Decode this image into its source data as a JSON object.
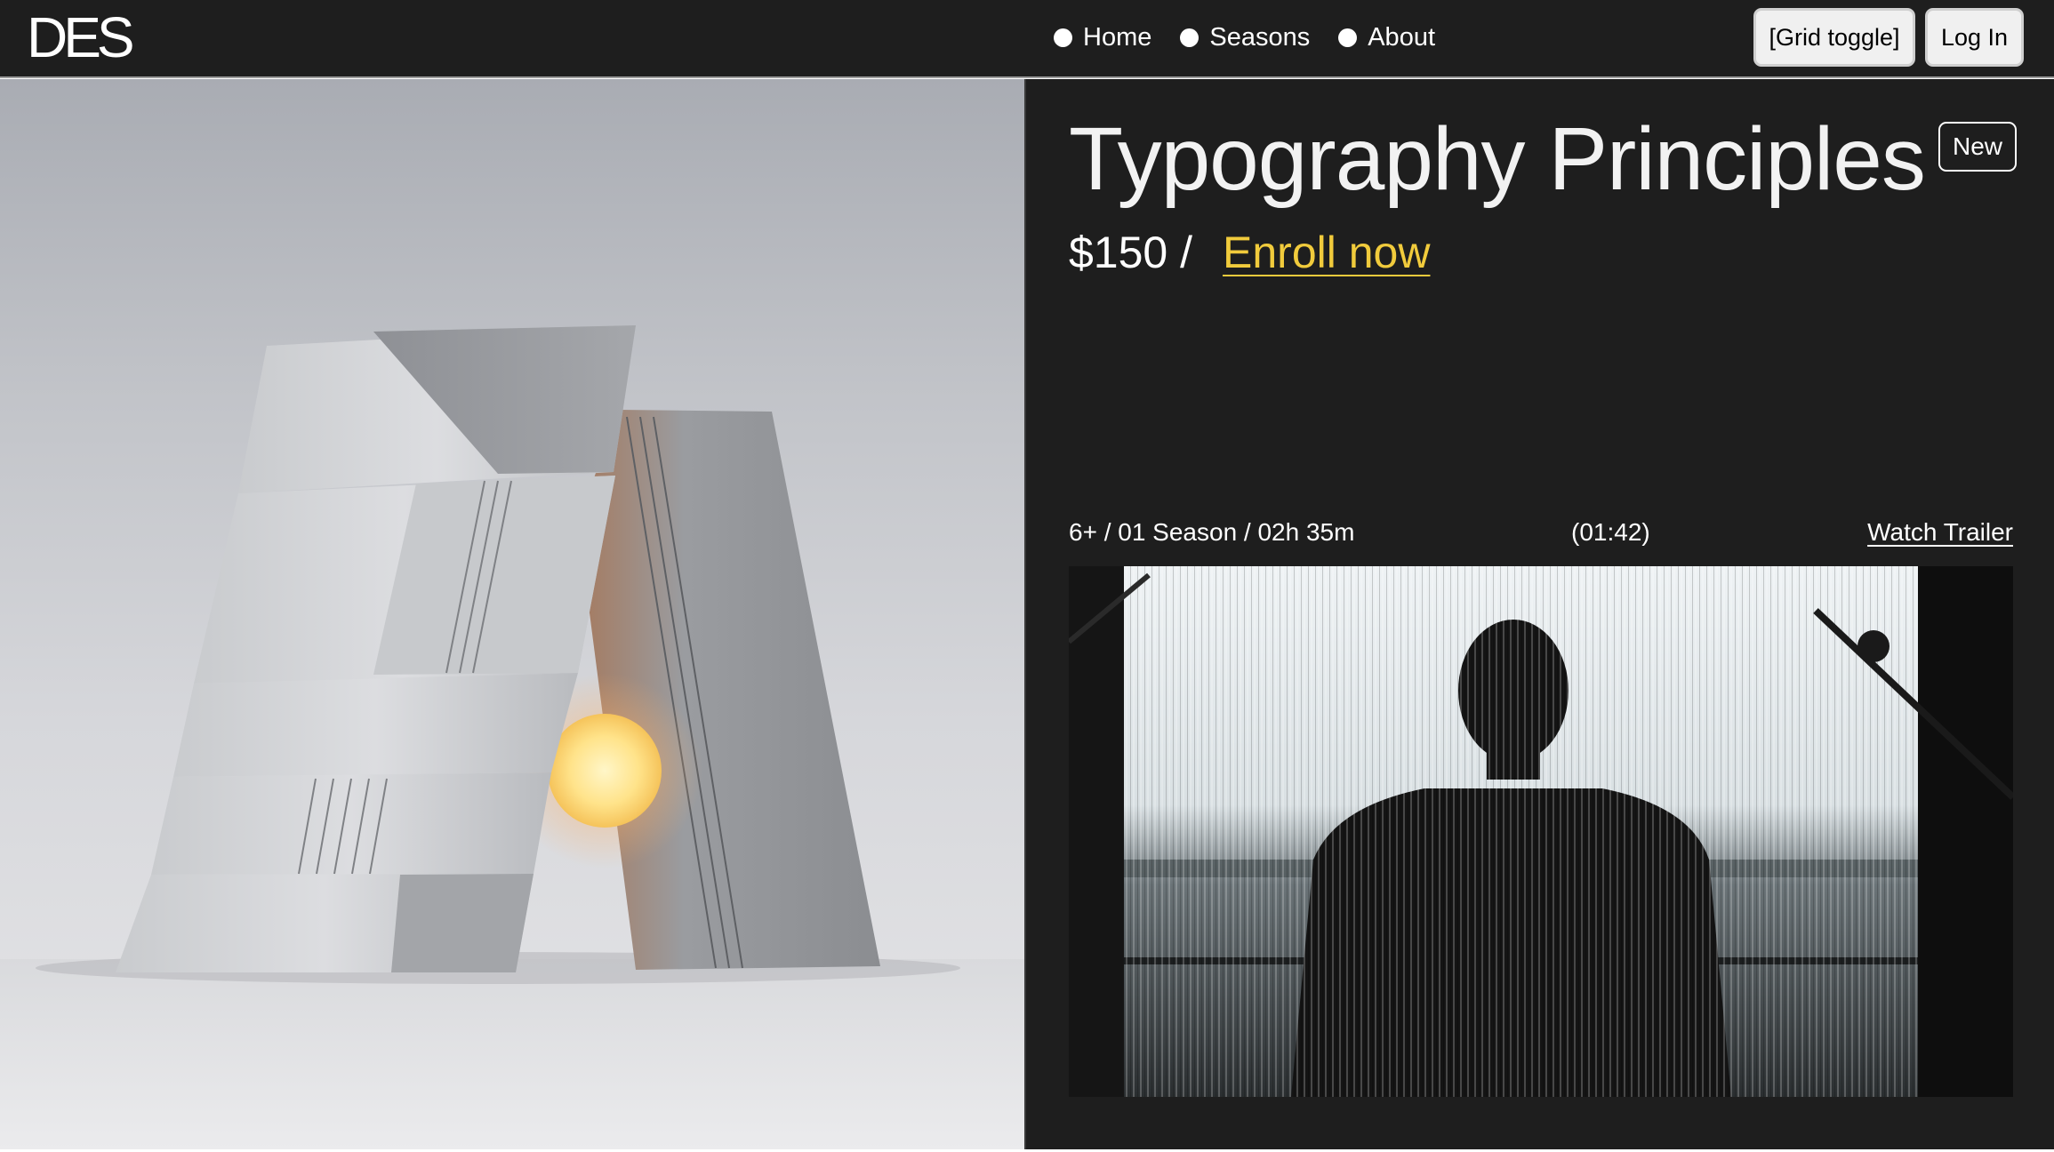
{
  "header": {
    "logo": "DES",
    "nav": [
      {
        "label": "Home"
      },
      {
        "label": "Seasons"
      },
      {
        "label": "About"
      }
    ],
    "grid_toggle_label": "[Grid toggle]",
    "login_label": "Log In"
  },
  "course": {
    "title": "Typography Principles",
    "badge": "New",
    "price": "$150 /",
    "enroll_label": "Enroll now",
    "meta": "6+ / 01 Season / 02h 35m",
    "duration": "(01:42)",
    "trailer_label": "Watch Trailer"
  },
  "colors": {
    "background": "#1e1e1e",
    "accent": "#f1cb3c",
    "text": "#ffffff"
  }
}
